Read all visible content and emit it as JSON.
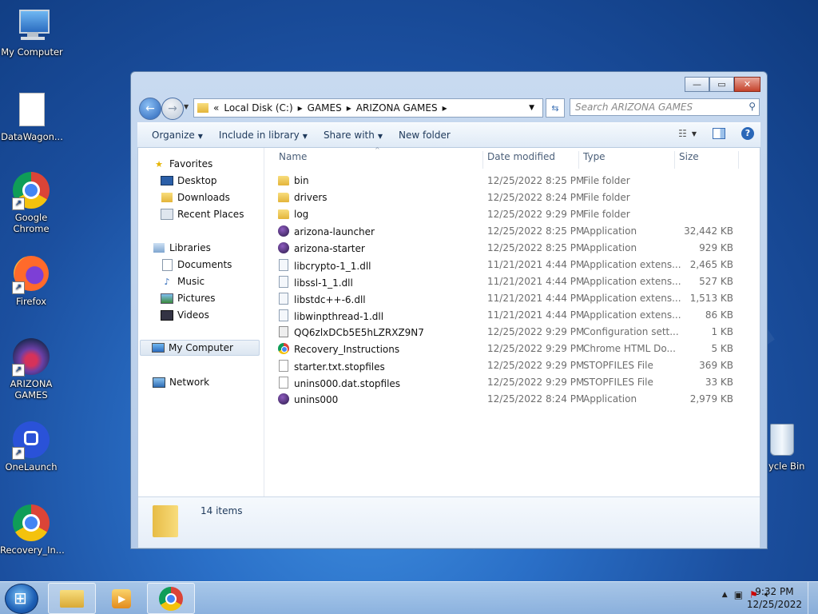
{
  "desktop": {
    "icons": [
      {
        "label": "My Computer"
      },
      {
        "label": "DataWagon..."
      },
      {
        "label": "Google Chrome"
      },
      {
        "label": "Firefox"
      },
      {
        "label": "ARIZONA GAMES"
      },
      {
        "label": "OneLaunch"
      },
      {
        "label": "Recovery_In..."
      },
      {
        "label": "ycle Bin"
      }
    ]
  },
  "window": {
    "caption_buttons": {
      "minimize": "—",
      "maximize": "▭",
      "close": "✕"
    },
    "address": {
      "prefix": "«",
      "crumbs": [
        "Local Disk (C:)",
        "GAMES",
        "ARIZONA GAMES"
      ]
    },
    "search_placeholder": "Search ARIZONA GAMES",
    "toolbar": {
      "organize": "Organize",
      "include_library": "Include in library",
      "share_with": "Share with",
      "new_folder": "New folder"
    },
    "nav": {
      "favorites": "Favorites",
      "desktop": "Desktop",
      "downloads": "Downloads",
      "recent_places": "Recent Places",
      "libraries": "Libraries",
      "documents": "Documents",
      "music": "Music",
      "pictures": "Pictures",
      "videos": "Videos",
      "my_computer": "My Computer",
      "network": "Network"
    },
    "columns": {
      "name": "Name",
      "date": "Date modified",
      "type": "Type",
      "size": "Size"
    },
    "files": [
      {
        "name": "bin",
        "date": "12/25/2022 8:25 PM",
        "type": "File folder",
        "size": "",
        "icon": "folder"
      },
      {
        "name": "drivers",
        "date": "12/25/2022 8:24 PM",
        "type": "File folder",
        "size": "",
        "icon": "folder"
      },
      {
        "name": "log",
        "date": "12/25/2022 9:29 PM",
        "type": "File folder",
        "size": "",
        "icon": "folder"
      },
      {
        "name": "arizona-launcher",
        "date": "12/25/2022 8:25 PM",
        "type": "Application",
        "size": "32,442 KB",
        "icon": "app"
      },
      {
        "name": "arizona-starter",
        "date": "12/25/2022 8:25 PM",
        "type": "Application",
        "size": "929 KB",
        "icon": "app"
      },
      {
        "name": "libcrypto-1_1.dll",
        "date": "11/21/2021 4:44 PM",
        "type": "Application extens...",
        "size": "2,465 KB",
        "icon": "dll"
      },
      {
        "name": "libssl-1_1.dll",
        "date": "11/21/2021 4:44 PM",
        "type": "Application extens...",
        "size": "527 KB",
        "icon": "dll"
      },
      {
        "name": "libstdc++-6.dll",
        "date": "11/21/2021 4:44 PM",
        "type": "Application extens...",
        "size": "1,513 KB",
        "icon": "dll"
      },
      {
        "name": "libwinpthread-1.dll",
        "date": "11/21/2021 4:44 PM",
        "type": "Application extens...",
        "size": "86 KB",
        "icon": "dll"
      },
      {
        "name": "QQ6zlxDCb5E5hLZRXZ9N7",
        "date": "12/25/2022 9:29 PM",
        "type": "Configuration sett...",
        "size": "1 KB",
        "icon": "cfg"
      },
      {
        "name": "Recovery_Instructions",
        "date": "12/25/2022 9:29 PM",
        "type": "Chrome HTML Do...",
        "size": "5 KB",
        "icon": "chrome"
      },
      {
        "name": "starter.txt.stopfiles",
        "date": "12/25/2022 9:29 PM",
        "type": "STOPFILES File",
        "size": "369 KB",
        "icon": "file"
      },
      {
        "name": "unins000.dat.stopfiles",
        "date": "12/25/2022 9:29 PM",
        "type": "STOPFILES File",
        "size": "33 KB",
        "icon": "file"
      },
      {
        "name": "unins000",
        "date": "12/25/2022 8:24 PM",
        "type": "Application",
        "size": "2,979 KB",
        "icon": "app"
      }
    ],
    "status": "14 items"
  },
  "taskbar": {
    "time": "9:32 PM",
    "date": "12/25/2022"
  }
}
